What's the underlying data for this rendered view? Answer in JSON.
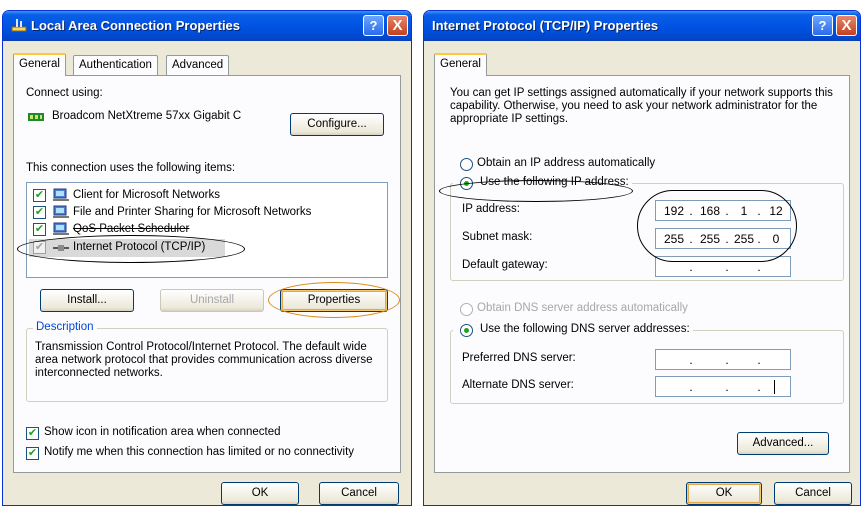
{
  "left_dialog": {
    "title": "Local Area Connection Properties",
    "help_button": "?",
    "close_button": "X",
    "tabs": [
      "General",
      "Authentication",
      "Advanced"
    ],
    "connect_using_label": "Connect using:",
    "adapter_name": "Broadcom NetXtreme 57xx Gigabit C",
    "configure_button": "Configure...",
    "items_label": "This connection uses the following items:",
    "items": [
      {
        "label": "Client for Microsoft Networks",
        "checked": true
      },
      {
        "label": "File and Printer Sharing for Microsoft Networks",
        "checked": true
      },
      {
        "label": "QoS Packet Scheduler",
        "checked": true
      },
      {
        "label": "Internet Protocol (TCP/IP)",
        "checked": true
      }
    ],
    "install_button": "Install...",
    "uninstall_button": "Uninstall",
    "properties_button": "Properties",
    "description_title": "Description",
    "description_text": "Transmission Control Protocol/Internet Protocol. The default wide area network protocol that provides communication across diverse interconnected networks.",
    "show_icon_label": "Show icon in notification area when connected",
    "notify_label": "Notify me when this connection has limited or no connectivity",
    "ok_button": "OK",
    "cancel_button": "Cancel"
  },
  "right_dialog": {
    "title": "Internet Protocol (TCP/IP) Properties",
    "help_button": "?",
    "close_button": "X",
    "tab": "General",
    "intro_text": "You can get IP settings assigned automatically if your network supports this capability. Otherwise, you need to ask your network administrator for the appropriate IP settings.",
    "obtain_ip_auto": "Obtain an IP address automatically",
    "use_following_ip": "Use the following IP address:",
    "ip_address_label": "IP address:",
    "ip_address": [
      "192",
      "168",
      "1",
      "12"
    ],
    "subnet_mask_label": "Subnet mask:",
    "subnet_mask": [
      "255",
      "255",
      "255",
      "0"
    ],
    "default_gateway_label": "Default gateway:",
    "obtain_dns_auto": "Obtain DNS server address automatically",
    "use_following_dns": "Use the following DNS server addresses:",
    "preferred_dns_label": "Preferred DNS server:",
    "alternate_dns_label": "Alternate DNS server:",
    "advanced_button": "Advanced...",
    "ok_button": "OK",
    "cancel_button": "Cancel"
  },
  "colors": {
    "title_bar": "#0054e3",
    "dialog_bg": "#ece9d8",
    "panel_bg": "#fcfcfe",
    "check_green": "#21a121",
    "highlight_orange": "#d88a18"
  }
}
